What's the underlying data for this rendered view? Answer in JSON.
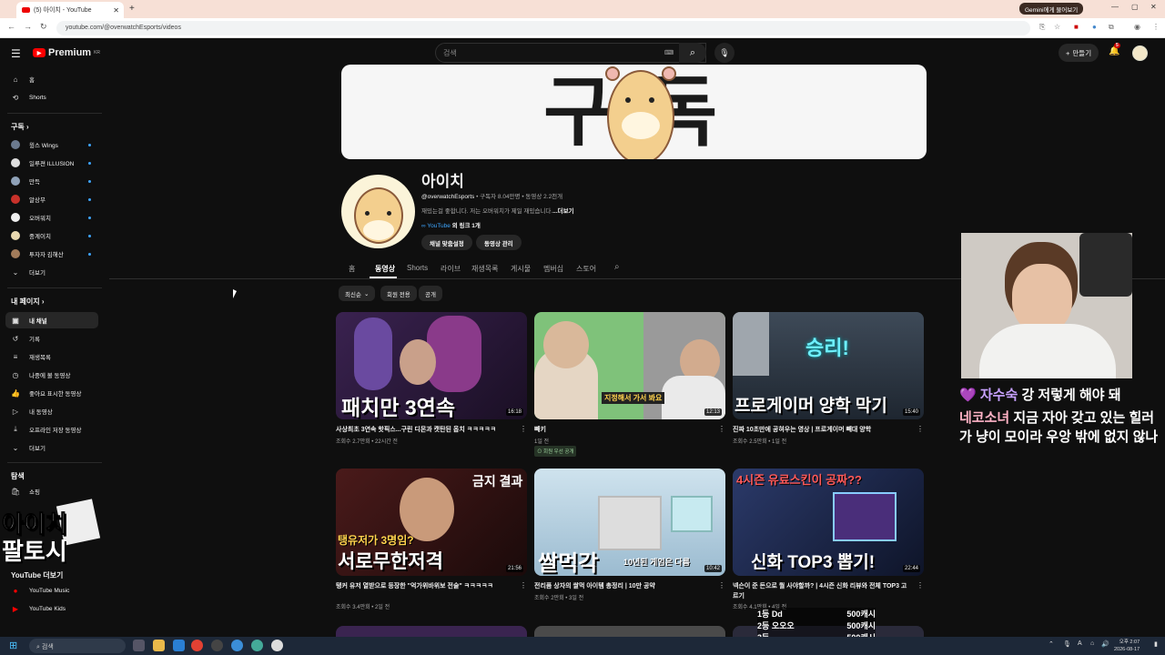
{
  "browser": {
    "tab_title": "(5) 아이치 - YouTube",
    "url": "youtube.com/@overwatchEsports/videos",
    "gemini_button": "Gemini에게 물어보기"
  },
  "yt": {
    "logo": "Premium",
    "region": "KR",
    "search_placeholder": "검색",
    "create_label": "만들기",
    "notif_count": "5"
  },
  "sidebar": {
    "top": [
      {
        "label": "홈",
        "icon": "home-icon"
      },
      {
        "label": "Shorts",
        "icon": "shorts-icon"
      }
    ],
    "subs_header": "구독",
    "subs": [
      {
        "label": "윙스 Wings",
        "color": "#6b7a8f"
      },
      {
        "label": "일루젼 ILLUSION",
        "color": "#dedede"
      },
      {
        "label": "만득",
        "color": "#8fa2b8"
      },
      {
        "label": "알상무",
        "color": "#c8312a"
      },
      {
        "label": "오버워치",
        "color": "#f0f0f0"
      },
      {
        "label": "중계이치",
        "color": "#e9d9b0"
      },
      {
        "label": "투자자 김해산",
        "color": "#a27c5b"
      }
    ],
    "more": "더보기",
    "you_header": "내 페이지",
    "you": [
      {
        "label": "내 채널"
      },
      {
        "label": "기록"
      },
      {
        "label": "재생목록"
      },
      {
        "label": "나중에 볼 동영상"
      },
      {
        "label": "좋아요 표시한 동영상"
      },
      {
        "label": "내 동영상"
      },
      {
        "label": "오프라인 저장 동영상"
      },
      {
        "label": "더보기"
      }
    ],
    "explore_header": "탐색",
    "explore": [
      {
        "label": "쇼핑"
      }
    ],
    "more_yt_header": "YouTube 더보기",
    "more_yt": [
      {
        "label": "YouTube Music"
      },
      {
        "label": "YouTube Kids"
      }
    ],
    "overlay_line1": "아이치",
    "overlay_line2": "팔토시"
  },
  "channel": {
    "banner_text_left": "구",
    "banner_text_right": "독",
    "name": "아이치",
    "handle": "@overwatchEsports",
    "meta": "• 구독자 8.04만명 • 동영상 2.2천개",
    "desc": "재밌는걸 좋합니다. 저는 오버워치가 제일 재밌습니다.",
    "desc_more": "...더보기",
    "link_prefix": "YouTube",
    "link_suffix": "외 링크 1개",
    "btn_customize": "채널 맞춤설정",
    "btn_manage": "동영상 관리"
  },
  "tabs": [
    "홈",
    "동영상",
    "Shorts",
    "라이브",
    "재생목록",
    "게시물",
    "멤버십",
    "스토어"
  ],
  "chips": [
    "최신순",
    "회원 전용",
    "공개"
  ],
  "videos": [
    {
      "title": "사상최초 3연속 핫픽스...구린 디몬과 캣탄된 옵치 ㅋㅋㅋㅋㅋ",
      "meta": "조회수 2.7만회 • 22시간 전",
      "duration": "16:18",
      "thumb_text": "패치만 3연속",
      "bg": "#2a1a3a"
    },
    {
      "title": "빼키",
      "meta": "1일 전",
      "duration": "12:13",
      "thumb_text": "지정해서 가서 봐요",
      "bg": "#7fc27a",
      "badge": "회원 우선 공개"
    },
    {
      "title": "진짜 10초만에 공혀우는 영상 | 프로게이머 빼대 양학",
      "meta": "조회수 2.5만회 • 1일 전",
      "duration": "15:40",
      "thumb_text": "프로게이머 양학 막기",
      "bg": "#2b3440",
      "thumb_text2": "승리!"
    },
    {
      "title": "탱커 유저 열받으로 등장한 \"억가위바위보 전술\" ㅋㅋㅋㅋㅋ",
      "meta": "조회수 3.4만회 • 2일 전",
      "duration": "21:56",
      "thumb_text": "서로무한저격",
      "bg": "#3a1a1a",
      "thumb_text2": "탱유저가 3명임?"
    },
    {
      "title": "전리품 상자의 쌀먹 아이템 총정리 | 10만 공약",
      "meta": "조회수 2만회 • 3일 전",
      "duration": "10:42",
      "thumb_text": "쌀먹각",
      "bg": "#b7d2e0",
      "thumb_text2": "10년된 게임은 다름"
    },
    {
      "title": "넥슨이 준 돈으로 뭘 사야할까? | 4시즌 신화 리뷰와 전체 TOP3 고르기",
      "meta": "조회수 4.1만회 • 4일 전",
      "duration": "22:44",
      "thumb_text": "신화 TOP3 뽑기!",
      "bg": "#1c2844",
      "thumb_text2": "4시즌 유료스킨이  공짜??"
    }
  ],
  "stream": {
    "chat": [
      {
        "name": "자수숙",
        "msg": "강 저렇게 해야 돼"
      },
      {
        "name": "네코소녀",
        "msg": "지금 자아 갖고 있는 힐러가 냥이 모이라 우앙 밖에 없지 않나"
      }
    ],
    "leaderboard": [
      {
        "rank": "1등",
        "name": "Dd",
        "amount": "500캐시"
      },
      {
        "rank": "2등",
        "name": "오오오",
        "amount": "500캐시"
      },
      {
        "rank": "3등",
        "name": "",
        "amount": "500캐시"
      }
    ]
  },
  "taskbar": {
    "search": "검색",
    "time": "오후 2:07",
    "date": "2026-08-17"
  }
}
